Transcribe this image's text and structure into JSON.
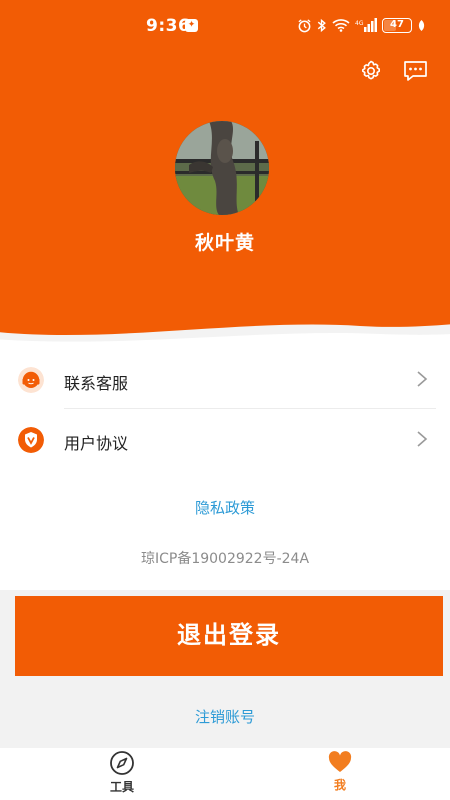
{
  "status_bar": {
    "time": "9:36",
    "battery": "47"
  },
  "header": {
    "settings_icon": "gear-icon",
    "message_icon": "chat-bubble-icon",
    "username": "秋叶黄"
  },
  "menu": {
    "items": [
      {
        "label": "联系客服",
        "icon": "headset-icon",
        "icon_color": "#f25c05"
      },
      {
        "label": "用户协议",
        "icon": "v-shield-icon",
        "icon_color": "#f25c05"
      }
    ]
  },
  "links": {
    "privacy": "隐私政策",
    "icp": "琼ICP备19002922号-24A",
    "cancel_account": "注销账号"
  },
  "logout": {
    "label": "退出登录"
  },
  "tabbar": {
    "tabs": [
      {
        "label": "工具",
        "icon": "compass-icon",
        "active": false
      },
      {
        "label": "我",
        "icon": "heart-icon",
        "active": true
      }
    ]
  },
  "colors": {
    "brand": "#f25c05",
    "link": "#2e9bd6",
    "active_tab": "#f27d1f"
  }
}
